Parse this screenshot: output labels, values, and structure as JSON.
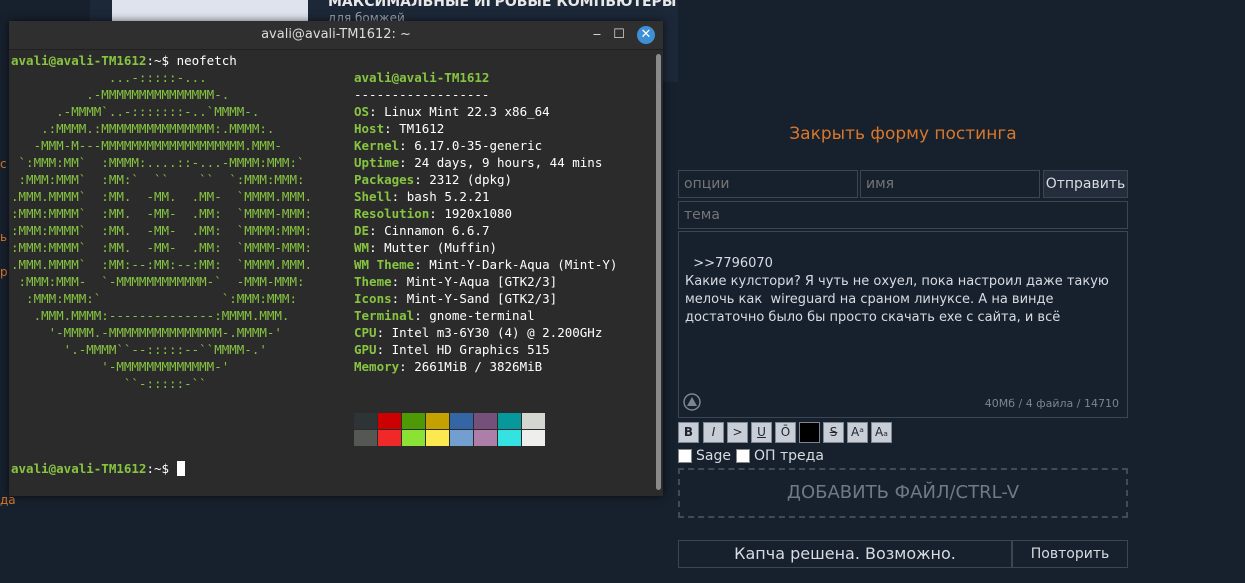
{
  "background": {
    "title": "МАКСИМАЛЬНЫЕ ИГРОВЫЕ КОМПЬЮТЕРЫ",
    "subtitle": "для бомжей",
    "edge_labels": [
      "с",
      "ь",
      "р",
      "да"
    ]
  },
  "terminal": {
    "window_title": "avali@avali-TM1612: ~",
    "prompt": "avali@avali-TM1612",
    "prompt_suffix": ":~$",
    "command": " neofetch",
    "logo_lines": [
      "             ...-:::::-...",
      "          .-MMMMMMMMMMMMMMM-.",
      "      .-MMMM`..-:::::::-..`MMMM-.",
      "    .:MMMM.:MMMMMMMMMMMMMMM:.MMMM:.",
      "   -MMM-M---MMMMMMMMMMMMMMMMMMM.MMM-",
      " `:MMM:MM`  :MMMM:....::-...-MMMM:MMM:`",
      " :MMM:MMM`  :MM:`  ``    ``  `:MMM:MMM:",
      ".MMM.MMMM`  :MM.  -MM.  .MM-  `MMMM.MMM.",
      ":MMM:MMMM`  :MM.  -MM-  .MM:  `MMMM-MMM:",
      ":MMM:MMMM`  :MM.  -MM-  .MM:  `MMMM:MMM:",
      ":MMM:MMMM`  :MM.  -MM-  .MM:  `MMMM-MMM:",
      ".MMM.MMMM`  :MM:--:MM:--:MM:  `MMMM.MMM.",
      " :MMM:MMM-  `-MMMMMMMMMMMM-`  -MMM-MMM:",
      "  :MMM:MMM:`                `:MMM:MMM:",
      "   .MMM.MMMM:--------------:MMMM.MMM.",
      "     '-MMMM.-MMMMMMMMMMMMMMM-.MMMM-'",
      "       '.-MMMM``--:::::--``MMMM-.'",
      "            '-MMMMMMMMMMMMM-'",
      "               ``-:::::-``"
    ],
    "user_host": "avali@avali-TM1612",
    "separator": "------------------",
    "info": [
      {
        "key": "OS",
        "value": "Linux Mint 22.3 x86_64"
      },
      {
        "key": "Host",
        "value": "TM1612"
      },
      {
        "key": "Kernel",
        "value": "6.17.0-35-generic"
      },
      {
        "key": "Uptime",
        "value": "24 days, 9 hours, 44 mins"
      },
      {
        "key": "Packages",
        "value": "2312 (dpkg)"
      },
      {
        "key": "Shell",
        "value": "bash 5.2.21"
      },
      {
        "key": "Resolution",
        "value": "1920x1080"
      },
      {
        "key": "DE",
        "value": "Cinnamon 6.6.7"
      },
      {
        "key": "WM",
        "value": "Mutter (Muffin)"
      },
      {
        "key": "WM Theme",
        "value": "Mint-Y-Dark-Aqua (Mint-Y)"
      },
      {
        "key": "Theme",
        "value": "Mint-Y-Aqua [GTK2/3]"
      },
      {
        "key": "Icons",
        "value": "Mint-Y-Sand [GTK2/3]"
      },
      {
        "key": "Terminal",
        "value": "gnome-terminal"
      },
      {
        "key": "CPU",
        "value": "Intel m3-6Y30 (4) @ 2.200GHz"
      },
      {
        "key": "GPU",
        "value": "Intel HD Graphics 515"
      },
      {
        "key": "Memory",
        "value": "2661MiB / 3826MiB"
      }
    ],
    "palette_dark": [
      "#2e3436",
      "#cc0000",
      "#4e9a06",
      "#c4a000",
      "#3465a4",
      "#75507b",
      "#06989a",
      "#d3d7cf"
    ],
    "palette_light": [
      "#555753",
      "#ef2929",
      "#8ae234",
      "#fce94f",
      "#729fcf",
      "#ad7fa8",
      "#34e2e2",
      "#eeeeec"
    ]
  },
  "form": {
    "close_link": "Закрыть форму постинга",
    "options_placeholder": "опции",
    "name_placeholder": "имя",
    "submit_label": "Отправить",
    "subject_placeholder": "тема",
    "message": ">>7796070\nКакие кулстори? Я чуть не охуел, пока настроил даже такую мелочь как  wireguard на сраном линуксе. А на винде достаточно было бы просто скачать exe с сайта, и всё",
    "counter": "40Мб / 4 файла / 14710",
    "format_buttons": [
      "B",
      "I",
      ">",
      "U",
      "Ō",
      "",
      "S",
      "Aᵃ",
      "Aₐ"
    ],
    "sage_label": "Sage",
    "op_label": "ОП треда",
    "dropzone": "ДОБАВИТЬ ФАЙЛ/CTRL-V",
    "captcha_status": "Капча решена. Возможно.",
    "retry_label": "Повторить"
  }
}
